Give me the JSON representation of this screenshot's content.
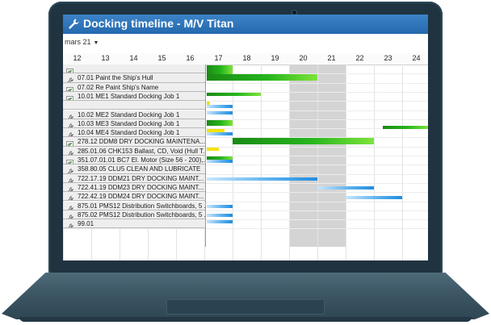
{
  "window": {
    "title": "Docking timeline - M/V Titan",
    "icon": "wrench-icon"
  },
  "toolbar": {
    "month_label": "mars 21",
    "month_dropdown_icon": "chevron-down-icon"
  },
  "timeline": {
    "days": [
      "12",
      "13",
      "14",
      "15",
      "16",
      "17",
      "18",
      "19",
      "20",
      "21",
      "22",
      "23",
      "24"
    ],
    "weekend_days": [
      "20",
      "21"
    ],
    "colors": {
      "green_bar": "#26b51d",
      "blue_bar": "#5fb3ee",
      "yellow_bar": "#f2e30e",
      "weekend_shade": "#d4d4d4",
      "title_bar": "#2f74b9"
    }
  },
  "tasks": [
    {
      "label": "",
      "icon": "job-icon"
    },
    {
      "label": "07.01 Paint the Ship's Hull",
      "icon": "wrench-icon"
    },
    {
      "label": "07.02 Re Paint Ship's Name",
      "icon": "job-icon"
    },
    {
      "label": "10.01 ME1 Standard Docking Job 1",
      "icon": "job-icon"
    },
    {
      "label": "",
      "icon": ""
    },
    {
      "label": "10.02 ME2 Standard Docking Job 1",
      "icon": "wrench-icon"
    },
    {
      "label": "10.03 ME3 Standard Docking Job 1",
      "icon": "wrench-icon"
    },
    {
      "label": "10.04 ME4 Standard Docking Job 1",
      "icon": "wrench-icon"
    },
    {
      "label": "278.12 DDM8 DRY DOCKING MAINTENA...",
      "icon": "job-icon"
    },
    {
      "label": "285.01.06 CHK153 Ballast, CD, Void (Hull T...",
      "icon": "wrench-icon"
    },
    {
      "label": "351.07.01.01 BC7 El. Motor (Size 56 - 200),...",
      "icon": "job-icon"
    },
    {
      "label": "358.80.05 CLU5 CLEAN AND LUBRICATE",
      "icon": "wrench-icon"
    },
    {
      "label": "722.17.19 DDM21 DRY DOCKING MAINT...",
      "icon": "wrench-icon"
    },
    {
      "label": "722.41.19 DDM23 DRY DOCKING MAINT...",
      "icon": "wrench-icon"
    },
    {
      "label": "722.42.19 DDM24 DRY DOCKING MAINT...",
      "icon": "wrench-icon"
    },
    {
      "label": "875.01 PMS12 Distribution Switchboards, 5 ...",
      "icon": "wrench-icon"
    },
    {
      "label": "875.02 PMS12 Distribution Switchboards, 5 ...",
      "icon": "wrench-icon"
    },
    {
      "label": "99.01",
      "icon": "wrench-icon"
    }
  ],
  "bars": [
    {
      "row": 0,
      "sub": 0,
      "start": "17",
      "end": "18",
      "status": "green"
    },
    {
      "row": 0,
      "sub": 1,
      "start": "17",
      "end": "18",
      "status": "green"
    },
    {
      "row": 0,
      "sub": 2,
      "start": "17",
      "end": "18",
      "status": "green"
    },
    {
      "row": 1,
      "sub": 0,
      "start": "17",
      "end": "21",
      "status": "green"
    },
    {
      "row": 1,
      "sub": 1,
      "start": "17",
      "end": "21",
      "status": "green"
    },
    {
      "row": 3,
      "sub": 0,
      "start": "17",
      "end": "19",
      "status": "green"
    },
    {
      "row": 4,
      "sub": 0,
      "start": "17",
      "end": "17.2",
      "status": "yellow"
    },
    {
      "row": 4,
      "sub": 1,
      "start": "17",
      "end": "18",
      "status": "blue"
    },
    {
      "row": 5,
      "sub": 0,
      "start": "17",
      "end": "18",
      "status": "blue"
    },
    {
      "row": 6,
      "sub": 0,
      "start": "17",
      "end": "18",
      "status": "green"
    },
    {
      "row": 6,
      "sub": 1,
      "start": "17",
      "end": "18",
      "status": "green"
    },
    {
      "row": 6,
      "sub": 2,
      "start": "23.3",
      "end": "25",
      "status": "green"
    },
    {
      "row": 7,
      "sub": 0,
      "start": "17",
      "end": "17.7",
      "status": "yellow"
    },
    {
      "row": 7,
      "sub": 1,
      "start": "17",
      "end": "18",
      "status": "blue"
    },
    {
      "row": 8,
      "sub": 0,
      "start": "18",
      "end": "23",
      "status": "green"
    },
    {
      "row": 8,
      "sub": 1,
      "start": "18",
      "end": "23",
      "status": "green"
    },
    {
      "row": 9,
      "sub": 0,
      "start": "17",
      "end": "17.5",
      "status": "yellow"
    },
    {
      "row": 10,
      "sub": 0,
      "start": "17",
      "end": "18",
      "status": "green"
    },
    {
      "row": 10,
      "sub": 1,
      "start": "17",
      "end": "18",
      "status": "blue"
    },
    {
      "row": 12,
      "sub": 1,
      "start": "17",
      "end": "21",
      "status": "blue"
    },
    {
      "row": 13,
      "sub": 1,
      "start": "21",
      "end": "23",
      "status": "blue"
    },
    {
      "row": 14,
      "sub": 1,
      "start": "22",
      "end": "24",
      "status": "blue"
    },
    {
      "row": 15,
      "sub": 1,
      "start": "17",
      "end": "18",
      "status": "blue"
    },
    {
      "row": 16,
      "sub": 1,
      "start": "17",
      "end": "18",
      "status": "blue"
    },
    {
      "row": 17,
      "sub": 0,
      "start": "17",
      "end": "18",
      "status": "blue"
    }
  ]
}
